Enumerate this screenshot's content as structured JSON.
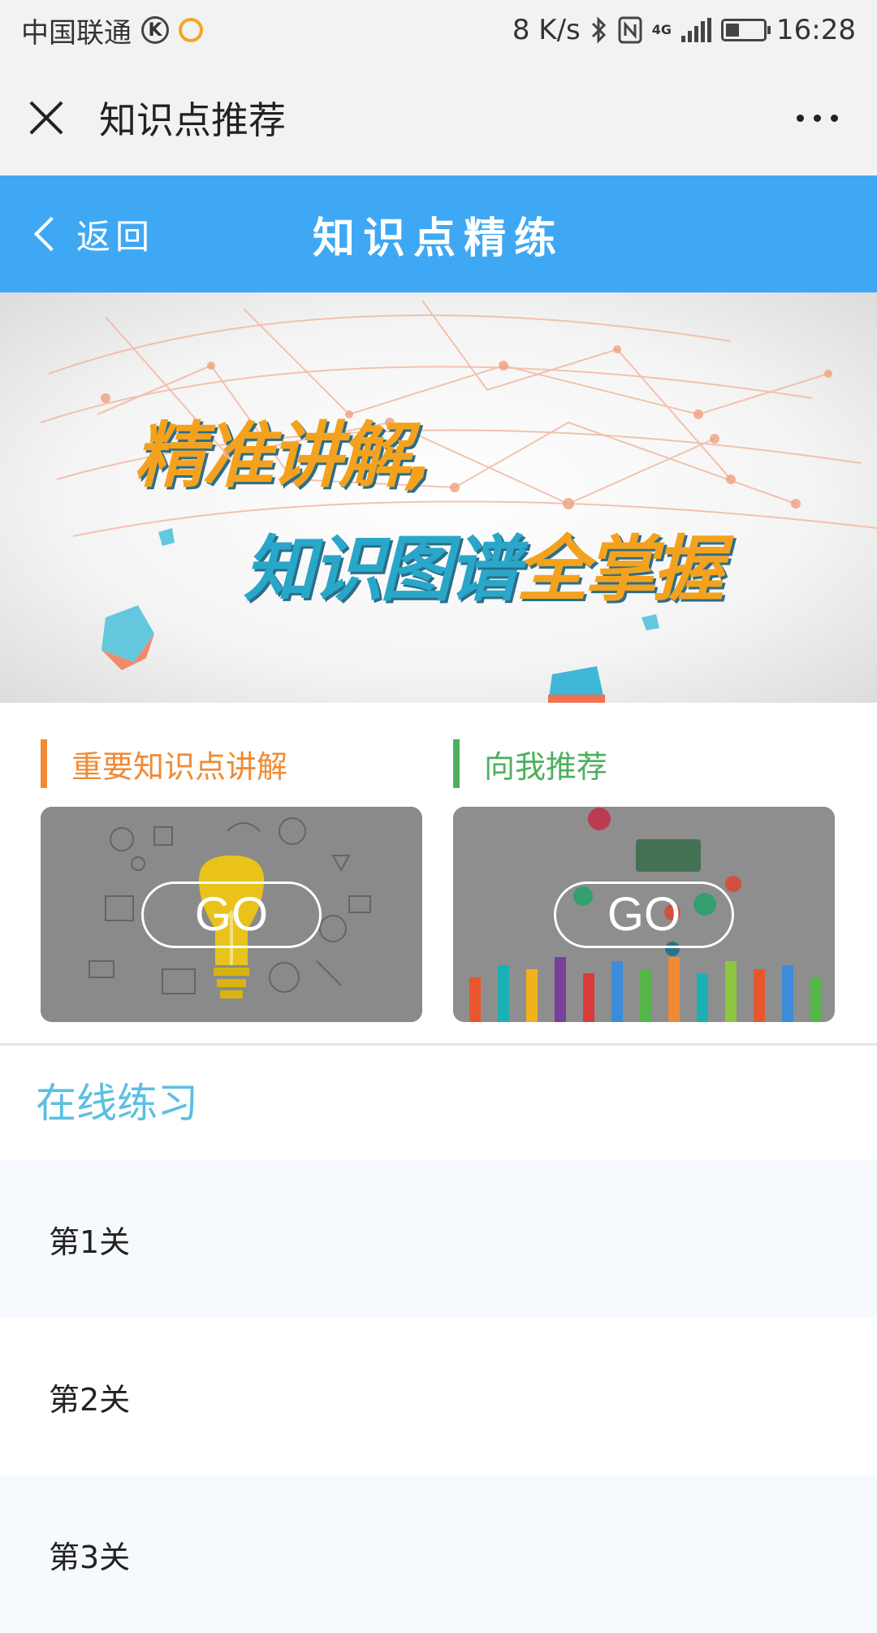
{
  "status_bar": {
    "carrier": "中国联通",
    "net_speed": "8 K/s",
    "network": "4G",
    "time": "16:28"
  },
  "app_bar": {
    "title": "知识点推荐",
    "icons": [
      "close-icon",
      "more-icon"
    ]
  },
  "header": {
    "back_label": "返回",
    "title": "知识点精练",
    "background": "#3ea8f4"
  },
  "banner": {
    "line1": "精准讲解,",
    "line2_blue": "知识图谱",
    "line2_orange": "全掌握"
  },
  "sections": [
    {
      "title": "重要知识点讲解",
      "color": "#f08a35",
      "button": "GO"
    },
    {
      "title": "向我推荐",
      "color": "#4cb05c",
      "button": "GO"
    }
  ],
  "practice": {
    "title": "在线练习",
    "levels": [
      "第1关",
      "第2关",
      "第3关"
    ]
  }
}
